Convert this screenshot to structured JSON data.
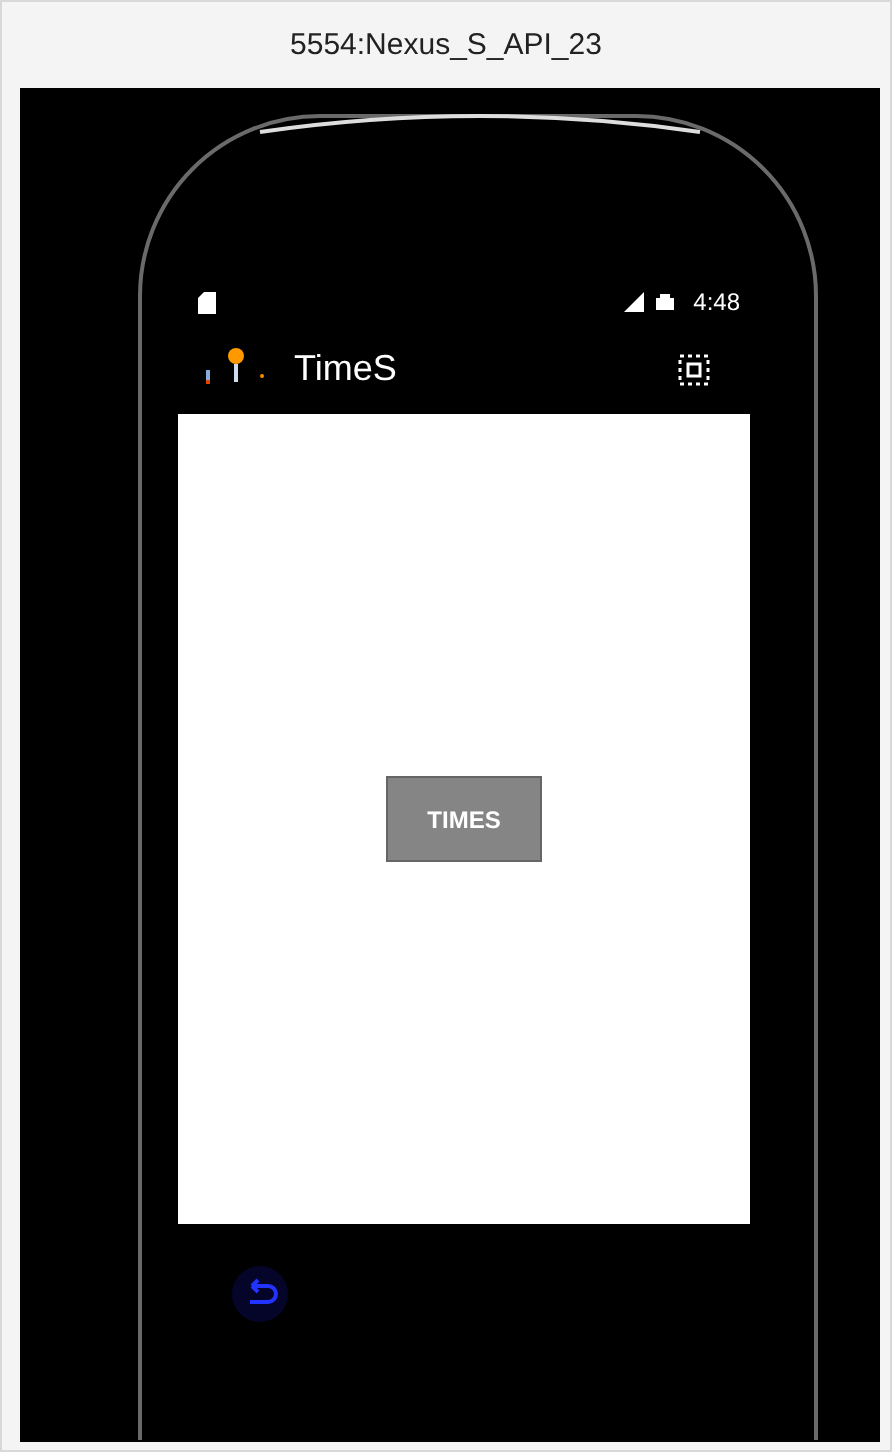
{
  "window": {
    "title": "5554:Nexus_S_API_23"
  },
  "status_bar": {
    "time": "4:48"
  },
  "app_bar": {
    "title": "TimeS"
  },
  "content": {
    "button": "TIMES"
  }
}
